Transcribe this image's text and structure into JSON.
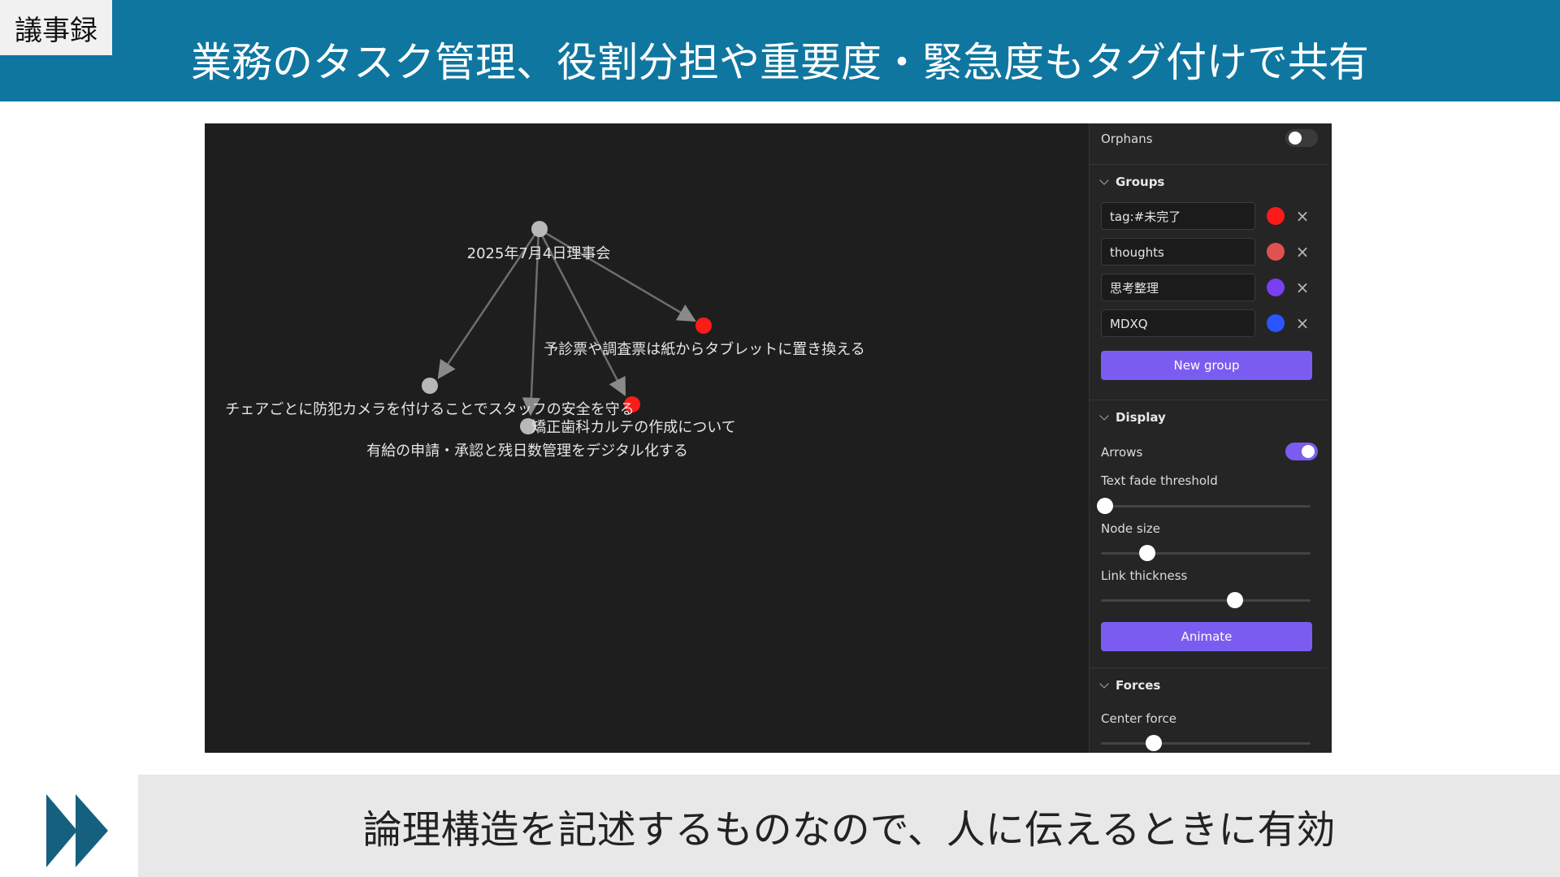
{
  "slide": {
    "tag": "議事録",
    "title": "業務のタスク管理、役割分担や重要度・緊急度もタグ付けで共有",
    "bottom_text": "論理構造を記述するものなので、人に伝えるときに有効",
    "header_color": "#0f76a0",
    "icon": "fast-forward-icon"
  },
  "graph": {
    "nodes": [
      {
        "id": "root",
        "label": "2025年7月4日理事会",
        "color": "#b8b8b8"
      },
      {
        "id": "n1",
        "label": "予診票や調査票は紙からタブレットに置き換える",
        "color": "#ff1a1a"
      },
      {
        "id": "n2",
        "label": "チェアごとに防犯カメラを付けることでスタッフの安全を守る",
        "color": "#b8b8b8"
      },
      {
        "id": "n3",
        "label": "矯正歯科カルテの作成について",
        "color": "#ff1a1a"
      },
      {
        "id": "n4",
        "label": "有給の申請・承認と残日数管理をデジタル化する",
        "color": "#b8b8b8"
      }
    ]
  },
  "panel": {
    "orphans_label": "Orphans",
    "orphans_on": false,
    "groups_header": "Groups",
    "groups": [
      {
        "query": "tag:#未完了",
        "color": "#ff1a1a"
      },
      {
        "query": "thoughts",
        "color": "#e05252"
      },
      {
        "query": "思考整理",
        "color": "#7a3ff0"
      },
      {
        "query": "MDXQ",
        "color": "#2a55ff"
      }
    ],
    "new_group_label": "New group",
    "display_header": "Display",
    "arrows_label": "Arrows",
    "arrows_on": true,
    "text_fade_label": "Text fade threshold",
    "text_fade_value": 0.02,
    "node_size_label": "Node size",
    "node_size_value": 0.22,
    "link_thickness_label": "Link thickness",
    "link_thickness_value": 0.64,
    "animate_label": "Animate",
    "forces_header": "Forces",
    "center_force_label": "Center force",
    "center_force_value": 0.25,
    "accent_color": "#7b5cf0"
  }
}
